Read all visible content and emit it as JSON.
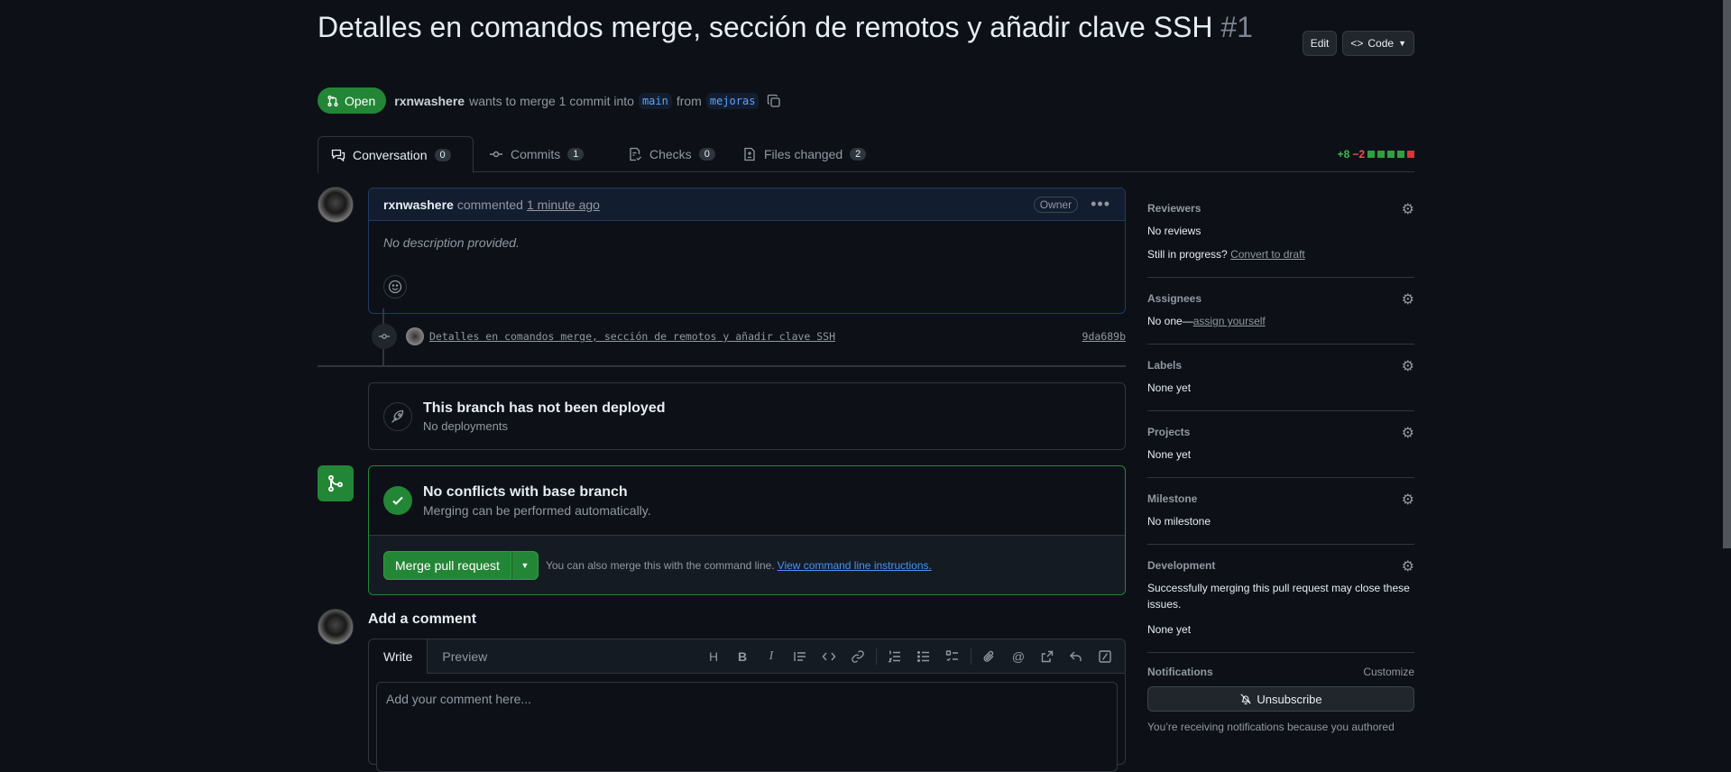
{
  "pr": {
    "title": "Detalles en comandos merge, sección de remotos y añadir clave SSH",
    "number": "#1",
    "state": "Open",
    "author": "rxnwashere",
    "meta_text": "wants to merge 1 commit into",
    "base_branch": "main",
    "from_text": "from",
    "head_branch": "mejoras"
  },
  "header_buttons": {
    "edit": "Edit",
    "code": "Code"
  },
  "tabs": [
    {
      "label": "Conversation",
      "count": "0"
    },
    {
      "label": "Commits",
      "count": "1"
    },
    {
      "label": "Checks",
      "count": "0"
    },
    {
      "label": "Files changed",
      "count": "2"
    }
  ],
  "diffstat": {
    "added": "+8",
    "removed": "−2",
    "green": "#2ea043",
    "red": "#da3633"
  },
  "comment": {
    "author": "rxnwashere",
    "action": "commented",
    "time": "1 minute ago",
    "badge": "Owner",
    "body": "No description provided."
  },
  "commit": {
    "message": "Detalles en comandos merge, sección de remotos y añadir clave SSH",
    "sha": "9da689b"
  },
  "deploy": {
    "title": "This branch has not been deployed",
    "subtitle": "No deployments"
  },
  "merge": {
    "title": "No conflicts with base branch",
    "subtitle": "Merging can be performed automatically.",
    "button": "Merge pull request",
    "hint": "You can also merge this with the command line.",
    "link": "View command line instructions."
  },
  "add_comment": {
    "title": "Add a comment",
    "tab_write": "Write",
    "tab_preview": "Preview",
    "placeholder": "Add your comment here..."
  },
  "sidebar": {
    "reviewers": {
      "title": "Reviewers",
      "value": "No reviews",
      "progress": "Still in progress?",
      "progress_link": "Convert to draft"
    },
    "assignees": {
      "title": "Assignees",
      "value": "No one—",
      "link": "assign yourself"
    },
    "labels": {
      "title": "Labels",
      "value": "None yet"
    },
    "projects": {
      "title": "Projects",
      "value": "None yet"
    },
    "milestone": {
      "title": "Milestone",
      "value": "No milestone"
    },
    "development": {
      "title": "Development",
      "desc": "Successfully merging this pull request may close these issues.",
      "value": "None yet"
    },
    "notifications": {
      "title": "Notifications",
      "customize": "Customize",
      "button": "Unsubscribe",
      "note": "You’re receiving notifications because you authored"
    }
  },
  "colors": {
    "accent_green": "#238636",
    "link_blue": "#4493f8",
    "background": "#0d1117"
  }
}
